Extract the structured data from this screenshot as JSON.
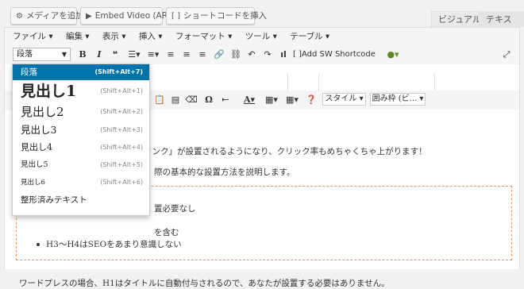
{
  "media_buttons": {
    "add_media": "メディアを追加",
    "embed_video": "Embed Video (ARVE)",
    "insert_shortcode": "ショートコードを挿入"
  },
  "tabs": {
    "visual": "ビジュアル",
    "text": "テキスト"
  },
  "menubar": {
    "items": [
      "ファイル ▾",
      "編集 ▾",
      "表示 ▾",
      "挿入 ▾",
      "フォーマット ▾",
      "ツール ▾",
      "テーブル ▾"
    ]
  },
  "toolbar1": {
    "format_select": "段落",
    "bold": "B",
    "italic": "I",
    "quote": "❝",
    "add_sw_shortcode": "Add SW Shortcode"
  },
  "toolbar2": {
    "omega": "Ω",
    "text_color": "A",
    "style_label": "スタイル ▾",
    "kakomi_label": "囲み枠 (ビ... ▾"
  },
  "format_dropdown": {
    "items": [
      {
        "label": "段落",
        "shortcut": "(Shift+Alt+7)"
      },
      {
        "label": "見出し1",
        "shortcut": "(Shift+Alt+1)"
      },
      {
        "label": "見出し2",
        "shortcut": "(Shift+Alt+2)"
      },
      {
        "label": "見出し3",
        "shortcut": "(Shift+Alt+3)"
      },
      {
        "label": "見出し4",
        "shortcut": "(Shift+Alt+4)"
      },
      {
        "label": "見出し5",
        "shortcut": "(Shift+Alt+5)"
      },
      {
        "label": "見出し6",
        "shortcut": "(Shift+Alt+6)"
      },
      {
        "label": "整形済みテキスト",
        "shortcut": ""
      }
    ]
  },
  "content": {
    "line1": "リンク」が設置されるようになり、クリック率もめちゃくちゃ上がります！",
    "line2": "際の基本的な設置方法を説明します。",
    "box_line1": "置必要なし",
    "box_line2": "を含む",
    "box_line3": "H3〜H4はSEOをあまり意識しない",
    "bottom_line": "ワードプレスの場合、H1はタイトルに自動付与されるので、あなたが設置する必要はありません。"
  }
}
